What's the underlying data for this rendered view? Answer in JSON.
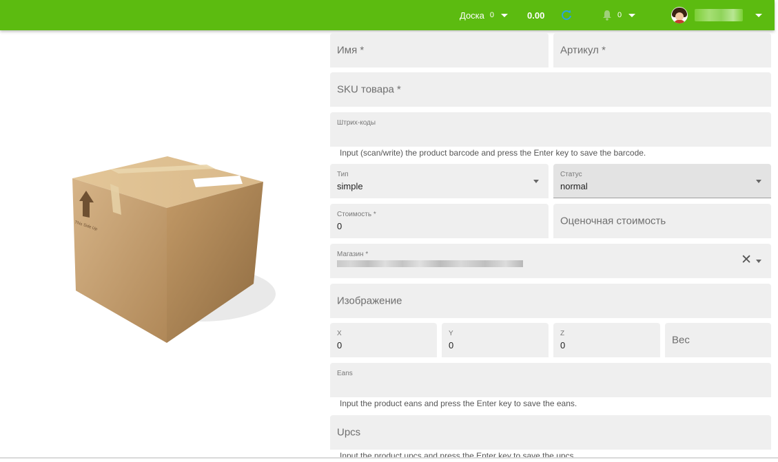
{
  "topbar": {
    "board_label": "Доска",
    "board_count": "0",
    "balance": "0.00",
    "notifications_count": "0"
  },
  "form": {
    "name_placeholder": "Имя *",
    "article_placeholder": "Артикул *",
    "sku_placeholder": "SKU товара *",
    "barcodes_label": "Штрих-коды",
    "barcodes_hint": "Input (scan/write) the product barcode and press the Enter key to save the barcode.",
    "type_label": "Тип",
    "type_value": "simple",
    "status_label": "Статус",
    "status_value": "normal",
    "cost_label": "Стоимость *",
    "cost_value": "0",
    "estimated_cost_placeholder": "Оценочная стоимость",
    "store_label": "Магазин *",
    "image_placeholder": "Изображение",
    "x_label": "X",
    "x_value": "0",
    "y_label": "Y",
    "y_value": "0",
    "z_label": "Z",
    "z_value": "0",
    "weight_placeholder": "Вес",
    "eans_label": "Eans",
    "eans_hint": "Input the product eans and press the Enter key to save the eans.",
    "upcs_placeholder": "Upcs",
    "upcs_hint": "Input the product upcs and press the Enter key to save the upcs."
  },
  "product_image": {
    "box_text": "This Side Up"
  },
  "colors": {
    "topbar": "#5cbb10",
    "field_bg": "#efefef",
    "refresh_icon": "#29a3e0"
  },
  "icons": [
    "caret-down-icon",
    "refresh-icon",
    "bell-icon",
    "avatar",
    "close-icon",
    "box-image"
  ]
}
